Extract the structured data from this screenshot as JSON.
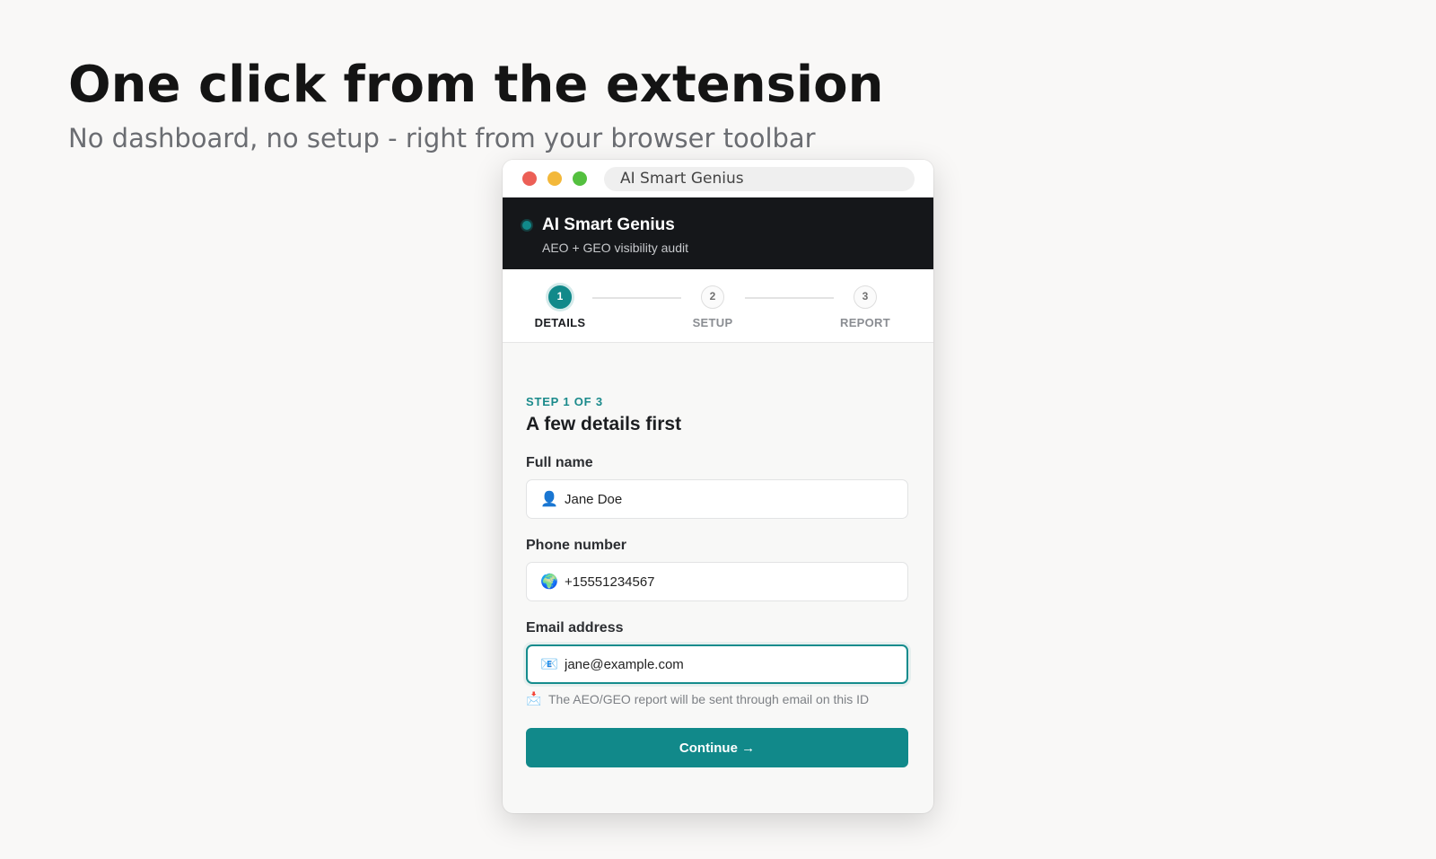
{
  "hero": {
    "title": "One click from the extension",
    "subtitle": "No dashboard, no setup - right from your browser toolbar"
  },
  "window": {
    "url_text": "AI Smart Genius",
    "controls": [
      "close",
      "minimize",
      "maximize"
    ]
  },
  "extension": {
    "brand": "AI Smart Genius",
    "tagline": "AEO + GEO visibility audit",
    "accent_color": "#11898a",
    "header_color": "#15171a"
  },
  "stepper": {
    "steps": [
      {
        "number": "1",
        "label": "DETAILS",
        "active": true
      },
      {
        "number": "2",
        "label": "SETUP",
        "active": false
      },
      {
        "number": "3",
        "label": "REPORT",
        "active": false
      }
    ]
  },
  "form": {
    "eyebrow": "STEP 1 OF 3",
    "title": "A few details first",
    "fields": [
      {
        "label": "Full name",
        "icon": "person-icon",
        "glyph": "👤",
        "value": "Jane Doe"
      },
      {
        "label": "Phone number",
        "icon": "globe-icon",
        "glyph": "🌍",
        "value": "+15551234567"
      },
      {
        "label": "Email address",
        "icon": "envelope-icon",
        "glyph": "📧",
        "value": "jane@example.com",
        "focused": true
      }
    ],
    "hint": {
      "icon": "inbox-icon",
      "glyph": "📩",
      "text": "The AEO/GEO report will be sent through email on this ID"
    },
    "continue_label": "Continue →"
  }
}
